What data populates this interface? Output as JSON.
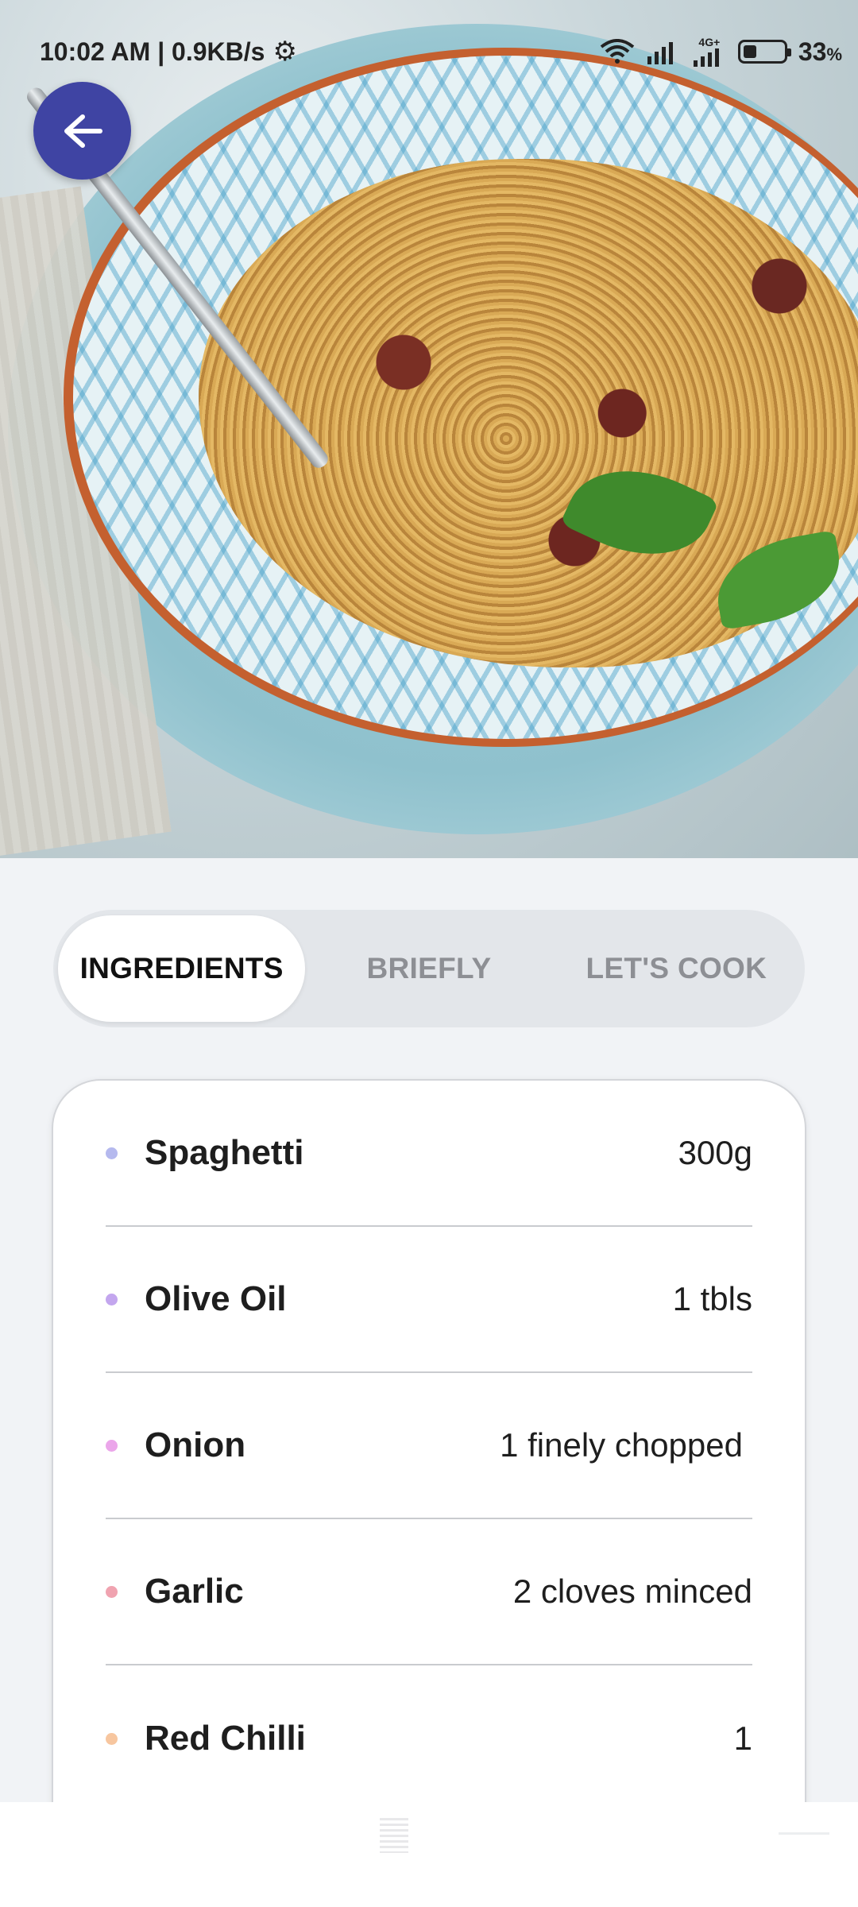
{
  "status_bar": {
    "time_speed": "10:02 AM | 0.9KB/s",
    "network_label": "4G+",
    "battery": "33",
    "battery_unit": "%"
  },
  "hero": {
    "icons": [
      "back-arrow-icon"
    ]
  },
  "tabs": [
    {
      "label": "INGREDIENTS",
      "active": true
    },
    {
      "label": "BRIEFLY",
      "active": false
    },
    {
      "label": "LET'S COOK",
      "active": false
    }
  ],
  "ingredients": [
    {
      "name": "Spaghetti",
      "quantity": "300g",
      "dot_color": "#b5b9ee"
    },
    {
      "name": "Olive Oil",
      "quantity": "1 tbls",
      "dot_color": "#c3a6ee"
    },
    {
      "name": "Onion",
      "quantity": "1 finely chopped",
      "dot_color": "#eba6ea"
    },
    {
      "name": "Garlic",
      "quantity": "2 cloves minced",
      "dot_color": "#f0a3b0"
    },
    {
      "name": "Red Chilli",
      "quantity": "1",
      "dot_color": "#f7c69f"
    }
  ],
  "colors": {
    "accent": "#3f44a3",
    "background": "#f1f3f6",
    "tab_track": "#e3e6ea"
  }
}
